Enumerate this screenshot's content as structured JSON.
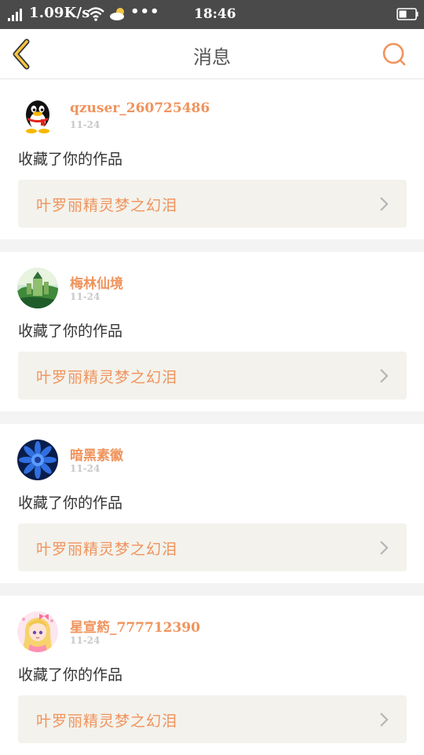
{
  "status_bar": {
    "speed": "1.09K/s",
    "more": "•••",
    "time": "18:46"
  },
  "header": {
    "title": "消息",
    "accent": "#f0935c",
    "back_icon": "chevron-left-icon",
    "search_icon": "search-icon"
  },
  "messages": [
    {
      "username": "qzuser_260725486",
      "date": "11-24",
      "action": "收藏了你的作品",
      "work": "叶罗丽精灵梦之幻泪",
      "avatar": "penguin-avatar"
    },
    {
      "username": "梅林仙境",
      "date": "11-24",
      "action": "收藏了你的作品",
      "work": "叶罗丽精灵梦之幻泪",
      "avatar": "castle-avatar"
    },
    {
      "username": "暗黑素徽",
      "date": "11-24",
      "action": "收藏了你的作品",
      "work": "叶罗丽精灵梦之幻泪",
      "avatar": "blue-flower-avatar"
    },
    {
      "username": "星宣箹_777712390",
      "date": "11-24",
      "action": "收藏了你的作品",
      "work": "叶罗丽精灵梦之幻泪",
      "avatar": "anime-girl-avatar"
    }
  ]
}
